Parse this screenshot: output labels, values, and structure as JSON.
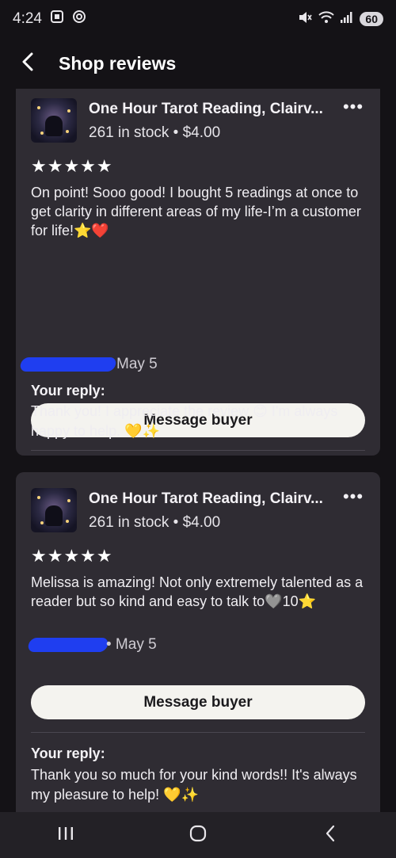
{
  "status": {
    "time": "4:24",
    "battery": "60"
  },
  "header": {
    "title": "Shop reviews"
  },
  "reviews": [
    {
      "listing_title": "One Hour Tarot Reading, Clairv...",
      "listing_meta": "261 in stock • $4.00",
      "stars": "★★★★★",
      "review_text": "On point! Sooo good! I bought 5 readings at once to get clarity in different areas of my life-I’m a customer for life!⭐❤️",
      "date": "May 5",
      "message_button": "Message buyer",
      "reply_label": "Your reply:",
      "reply_text": "Thank you! I appreciate the review 😊 I'm always happy to help. 💛✨"
    },
    {
      "listing_title": "One Hour Tarot Reading, Clairv...",
      "listing_meta": "261 in stock • $4.00",
      "stars": "★★★★★",
      "review_text": "Melissa is amazing! Not only extremely talented as a reader but so kind and easy to talk to🩶10⭐",
      "date": "• May 5",
      "message_button": "Message buyer",
      "reply_label": "Your reply:",
      "reply_text": "Thank you so much for your kind words!! It's always my pleasure to help! 💛✨"
    }
  ],
  "colors": {
    "background": "#141216",
    "card": "#2f2c33",
    "button": "#f4f3ef",
    "redaction": "#1f3ef0"
  },
  "icons": {
    "back": "arrow-back-icon",
    "more": "more-horizontal-icon",
    "nav_recents": "recents-icon",
    "nav_home": "home-icon",
    "nav_back": "nav-back-icon"
  }
}
